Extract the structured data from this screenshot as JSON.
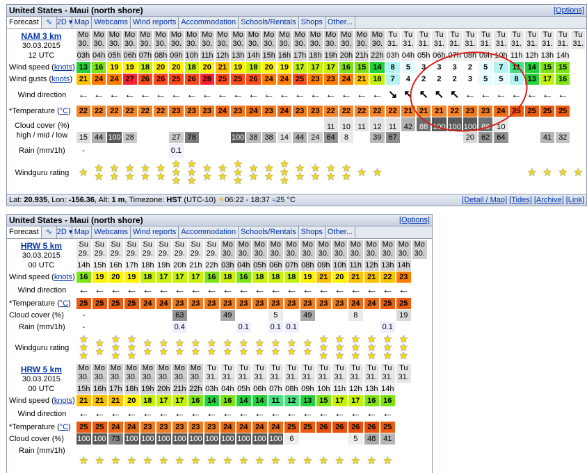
{
  "window_title": "United States - Maui (north shore)",
  "options_label": "[Options]",
  "tabs": [
    "Forecast",
    "∿",
    "2D ▾",
    "Map",
    "Webcams",
    "Wind reports",
    "Accommodation",
    "Schools/Rentals",
    "Shops",
    "Other..."
  ],
  "tabs_short": [
    "Forecast",
    "∿",
    "2D ▾",
    "Map",
    "Webcams",
    "Wind reports",
    "Accommodation",
    "Schools/Rentals",
    "Shops",
    "Other..."
  ],
  "footer": {
    "lat_label": "Lat:",
    "lat": "20.935",
    "lon_label": ", Lon:",
    "lon": "-156.36",
    "alt_label": ", Alt:",
    "alt": "1 m",
    "tz_label": ", Timezone:",
    "tz": "HST",
    "tz_offset": "(UTC-10)",
    "sun": "06:22 - 18:37",
    "water": "25 °C",
    "links": [
      "[Detail / Map]",
      "[Tides]",
      "[Archive]",
      "[Link]"
    ]
  },
  "colors": {
    "red_annotation": "#d91e18"
  },
  "models": [
    {
      "name": "NAM 3 km",
      "date": "30.03.2015",
      "run": "12 UTC",
      "days": [
        "Mo",
        "Mo",
        "Mo",
        "Mo",
        "Mo",
        "Mo",
        "Mo",
        "Mo",
        "Mo",
        "Mo",
        "Mo",
        "Mo",
        "Mo",
        "Mo",
        "Mo",
        "Mo",
        "Mo",
        "Mo",
        "Mo",
        "Mo",
        "Tu",
        "Tu",
        "Tu",
        "Tu",
        "Tu",
        "Tu",
        "Tu",
        "Tu",
        "Tu",
        "Tu",
        "Tu",
        "Tu",
        "Tu"
      ],
      "dates": [
        "30.",
        "30.",
        "30.",
        "30.",
        "30.",
        "30.",
        "30.",
        "30.",
        "30.",
        "30.",
        "30.",
        "30.",
        "30.",
        "30.",
        "30.",
        "30.",
        "30.",
        "30.",
        "30.",
        "30.",
        "31.",
        "31.",
        "31.",
        "31.",
        "31.",
        "31.",
        "31.",
        "31.",
        "31.",
        "31.",
        "31.",
        "31.",
        "31."
      ],
      "hours": [
        "03h",
        "04h",
        "05h",
        "06h",
        "07h",
        "08h",
        "09h",
        "10h",
        "11h",
        "12h",
        "13h",
        "14h",
        "15h",
        "16h",
        "17h",
        "18h",
        "19h",
        "20h",
        "21h",
        "22h",
        "03h",
        "04h",
        "05h",
        "06h",
        "07h",
        "08h",
        "09h",
        "10h",
        "11h",
        "12h",
        "13h",
        "14h"
      ],
      "hours_full": [
        "03h",
        "04h",
        "05h",
        "06h",
        "07h",
        "08h",
        "09h",
        "10h",
        "11h",
        "12h",
        "13h",
        "14h",
        "15h",
        "16h",
        "17h",
        "18h",
        "19h",
        "20h",
        "21h",
        "22h",
        "03h",
        "04h",
        "05h",
        "06h",
        "07h",
        "08h",
        "09h",
        "10h",
        "11h",
        "12h",
        "13h",
        "14h"
      ],
      "wind_label": "Wind speed (",
      "wind_link": "knots",
      "wind_close": ")",
      "wind": [
        "13",
        "16",
        "19",
        "19",
        "18",
        "20",
        "20",
        "18",
        "20",
        "21",
        "19",
        "18",
        "20",
        "19",
        "17",
        "17",
        "17",
        "16",
        "15",
        "14",
        "8",
        "5",
        "3",
        "3",
        "3",
        "2",
        "5",
        "7",
        "11",
        "14",
        "15",
        "15"
      ],
      "gust_label": "Wind gusts (",
      "gusts": [
        "21",
        "24",
        "24",
        "27",
        "26",
        "26",
        "25",
        "26",
        "28",
        "25",
        "25",
        "26",
        "24",
        "24",
        "25",
        "23",
        "23",
        "24",
        "21",
        "18",
        "7",
        "4",
        "2",
        "2",
        "2",
        "3",
        "5",
        "5",
        "8",
        "13",
        "17",
        "16"
      ],
      "dir_label": "Wind direction",
      "dirs": [
        "←",
        "←",
        "←",
        "←",
        "←",
        "←",
        "←",
        "←",
        "←",
        "←",
        "←",
        "←",
        "←",
        "←",
        "←",
        "←",
        "←",
        "←",
        "←",
        "←",
        "↘",
        "↖",
        "↖",
        "↖",
        "↖",
        "←",
        "←",
        "←",
        "←",
        "←",
        "←",
        "←"
      ],
      "temp_label": "*Temperature (",
      "temp_link": "°C",
      "temps": [
        "22",
        "22",
        "22",
        "22",
        "22",
        "22",
        "23",
        "23",
        "23",
        "24",
        "23",
        "24",
        "23",
        "24",
        "23",
        "23",
        "22",
        "22",
        "22",
        "22",
        "22",
        "21",
        "21",
        "21",
        "22",
        "23",
        "23",
        "24",
        "25",
        "25",
        "25",
        "25"
      ],
      "cloud_label": "Cloud cover (%)",
      "cloud_sub": "high / mid / low",
      "cloud_high": [
        "",
        "",
        "",
        "",
        "",
        "",
        "",
        "",
        "",
        "",
        "",
        "",
        "",
        "",
        "",
        "",
        "11",
        "10",
        "11",
        "12",
        "11",
        "42",
        "88",
        "100",
        "100",
        "100",
        "86",
        "10",
        "",
        "",
        "",
        ""
      ],
      "cloud_low": [
        "15",
        "44",
        "100",
        "28",
        "",
        "",
        "27",
        "78",
        "",
        "",
        "100",
        "38",
        "38",
        "14",
        "44",
        "24",
        "64",
        "8",
        "",
        "39",
        "67",
        "",
        "",
        "",
        "",
        "20",
        "62",
        "64",
        "",
        "",
        "41",
        "32"
      ],
      "rain_label": "Rain (mm/1h)",
      "rain": [
        "-",
        "",
        "",
        "",
        "",
        "",
        "0.1",
        "",
        "",
        "",
        "",
        "",
        "",
        "",
        "",
        "",
        "",
        "",
        "",
        "",
        "",
        "",
        "",
        "",
        "",
        "",
        "",
        "",
        "",
        "",
        "",
        ""
      ],
      "rating_label": "Windguru rating",
      "rating": [
        1,
        2,
        2,
        2,
        2,
        2,
        3,
        3,
        2,
        2,
        3,
        2,
        2,
        3,
        2,
        2,
        2,
        2,
        1,
        1,
        0,
        0,
        0,
        0,
        0,
        0,
        0,
        0,
        0,
        1,
        1,
        1,
        1
      ]
    },
    {
      "name": "HRW 5 km",
      "date": "30.03.2015",
      "run": "00 UTC",
      "days": [
        "Su",
        "Su",
        "Su",
        "Su",
        "Su",
        "Su",
        "Su",
        "Su",
        "Su",
        "Mo",
        "Mo",
        "Mo",
        "Mo",
        "Mo",
        "Mo",
        "Mo",
        "Mo",
        "Mo",
        "Mo",
        "Mo",
        "Mo",
        "Mo"
      ],
      "dates": [
        "29.",
        "29.",
        "29.",
        "29.",
        "29.",
        "29.",
        "29.",
        "29.",
        "29.",
        "30.",
        "30.",
        "30.",
        "30.",
        "30.",
        "30.",
        "30.",
        "30.",
        "30.",
        "30.",
        "30.",
        "30.",
        "30."
      ],
      "hours": [
        "14h",
        "15h",
        "16h",
        "17h",
        "18h",
        "19h",
        "20h",
        "21h",
        "22h",
        "03h",
        "04h",
        "05h",
        "06h",
        "07h",
        "08h",
        "09h",
        "10h",
        "11h",
        "12h",
        "13h",
        "14h"
      ],
      "wind": [
        "16",
        "19",
        "20",
        "19",
        "18",
        "17",
        "17",
        "17",
        "16",
        "18",
        "16",
        "18",
        "18",
        "18",
        "19",
        "21",
        "20",
        "21",
        "21",
        "22",
        "23"
      ],
      "temps": [
        "25",
        "25",
        "25",
        "25",
        "24",
        "24",
        "23",
        "23",
        "23",
        "23",
        "23",
        "23",
        "23",
        "23",
        "23",
        "23",
        "23",
        "24",
        "24",
        "25",
        "25"
      ],
      "cloud": [
        "-",
        "",
        "",
        "",
        "",
        "",
        "63",
        "",
        "",
        "49",
        "",
        "",
        "5",
        "",
        "49",
        "",
        "",
        "8",
        "",
        "",
        "19"
      ],
      "rain": [
        "-",
        "",
        "",
        "",
        "",
        "",
        "0.4",
        "",
        "",
        "",
        "0.1",
        "",
        "0.1",
        "0.1",
        "",
        "",
        "",
        "",
        "",
        "0.1",
        ""
      ],
      "rating": [
        3,
        2,
        3,
        3,
        2,
        2,
        2,
        2,
        2,
        2,
        2,
        2,
        2,
        2,
        2,
        3,
        3,
        3,
        3,
        3,
        3
      ]
    },
    {
      "name": "HRW 5 km",
      "date": "30.03.2015",
      "run": "00 UTC",
      "days": [
        "Mo",
        "Mo",
        "Mo",
        "Mo",
        "Mo",
        "Mo",
        "Mo",
        "Mo",
        "Tu",
        "Tu",
        "Tu",
        "Tu",
        "Tu",
        "Tu",
        "Tu",
        "Tu",
        "Tu",
        "Tu",
        "Tu",
        "Tu",
        "Tu"
      ],
      "dates": [
        "30.",
        "30.",
        "30.",
        "30.",
        "30.",
        "30.",
        "30.",
        "30.",
        "31.",
        "31.",
        "31.",
        "31.",
        "31.",
        "31.",
        "31.",
        "31.",
        "31.",
        "31.",
        "31.",
        "31.",
        "31."
      ],
      "hours": [
        "15h",
        "16h",
        "17h",
        "18h",
        "19h",
        "20h",
        "21h",
        "22h",
        "03h",
        "04h",
        "05h",
        "06h",
        "07h",
        "08h",
        "09h",
        "10h",
        "11h",
        "12h",
        "13h",
        "14h"
      ],
      "wind": [
        "21",
        "21",
        "21",
        "20",
        "18",
        "17",
        "17",
        "16",
        "14",
        "16",
        "14",
        "14",
        "11",
        "12",
        "13",
        "15",
        "17",
        "17",
        "16",
        "16"
      ],
      "temps": [
        "25",
        "25",
        "24",
        "24",
        "23",
        "23",
        "23",
        "23",
        "23",
        "24",
        "24",
        "24",
        "24",
        "25",
        "25",
        "26",
        "26",
        "26",
        "26",
        "25"
      ],
      "cloud": [
        "100",
        "100",
        "73",
        "100",
        "100",
        "100",
        "100",
        "100",
        "100",
        "100",
        "100",
        "100",
        "100",
        "6",
        "",
        "",
        "",
        "5",
        "48",
        "41"
      ],
      "rating": [
        1,
        1,
        1,
        1,
        1,
        1,
        1,
        1,
        1,
        1,
        1,
        1,
        1,
        1,
        1,
        1,
        1,
        1,
        1,
        1
      ]
    }
  ]
}
